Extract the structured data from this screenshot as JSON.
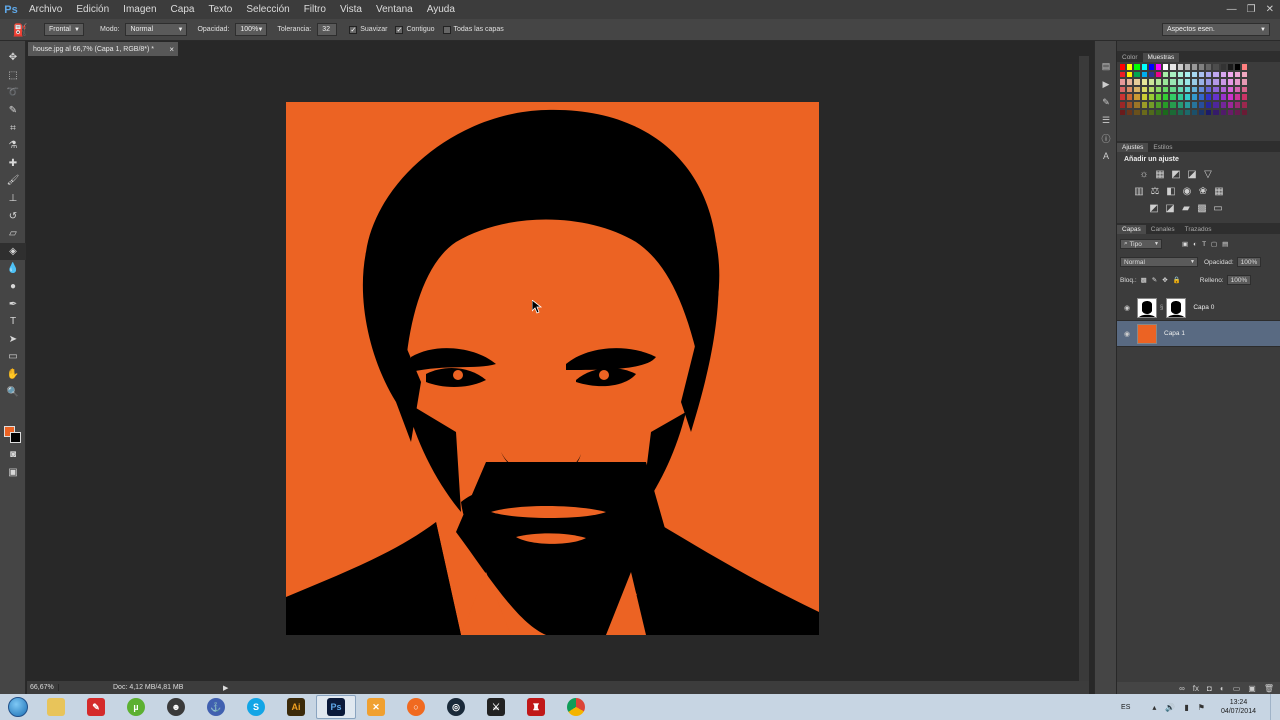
{
  "app": {
    "logo": "Ps"
  },
  "menu": [
    "Archivo",
    "Edición",
    "Imagen",
    "Capa",
    "Texto",
    "Selección",
    "Filtro",
    "Vista",
    "Ventana",
    "Ayuda"
  ],
  "window_controls": [
    "—",
    "❐",
    "✕"
  ],
  "options": {
    "preset": "Frontal",
    "mode_label": "Modo:",
    "mode_value": "Normal",
    "opacity_label": "Opacidad:",
    "opacity_value": "100%",
    "tolerance_label": "Tolerancia:",
    "tolerance_value": "32",
    "antialias_label": "Suavizar",
    "antialias_checked": true,
    "contiguous_label": "Contiguo",
    "contiguous_checked": true,
    "all_layers_label": "Todas las capas",
    "all_layers_checked": false,
    "workspace": "Aspectos esen."
  },
  "document": {
    "tab_title": "house.jpg al 66,7% (Capa 1, RGB/8*) *",
    "canvas_color": "#ec6323"
  },
  "status": {
    "zoom": "66,67%",
    "doc_size": "Doc: 4,12 MB/4,81 MB"
  },
  "colors": {
    "foreground": "#ec6323",
    "background": "#000000",
    "accent": "#ec6323"
  },
  "panels": {
    "top_tabs": [
      "Color",
      "Muestras"
    ],
    "adj_tabs": [
      "Ajustes",
      "Estilos"
    ],
    "adj_title": "Añadir un ajuste",
    "layer_tabs": [
      "Capas",
      "Canales",
      "Trazados"
    ],
    "filter_kind": "Tipo",
    "blend_mode": "Normal",
    "opacity_label": "Opacidad:",
    "opacity_value": "100%",
    "lock_label": "Bloq.:",
    "fill_label": "Relleno:",
    "fill_value": "100%"
  },
  "layers": [
    {
      "name": "Capa 0",
      "selected": false,
      "has_mask": true
    },
    {
      "name": "Capa 1",
      "selected": true,
      "has_mask": false
    }
  ],
  "taskbar": {
    "apps": [
      "explorer",
      "pen-tool",
      "utorrent",
      "inkscape",
      "anchor-app",
      "skype",
      "illustrator",
      "photoshop",
      "x-app",
      "origin",
      "steam",
      "game-app",
      "red-app",
      "chrome"
    ],
    "lang": "ES",
    "time": "13:24",
    "date": "04/07/2014"
  }
}
